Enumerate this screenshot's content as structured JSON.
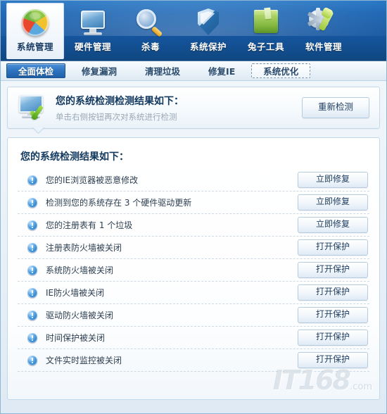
{
  "toolbar": {
    "items": [
      {
        "label": "系统管理",
        "icon": "pie-chart-icon",
        "active": true
      },
      {
        "label": "硬件管理",
        "icon": "monitor-icon",
        "active": false
      },
      {
        "label": "杀毒",
        "icon": "magnifier-icon",
        "active": false
      },
      {
        "label": "系统保护",
        "icon": "shield-icon",
        "active": false
      },
      {
        "label": "兔子工具",
        "icon": "box-icon",
        "active": false
      },
      {
        "label": "软件管理",
        "icon": "gear-wrench-icon",
        "active": false
      }
    ]
  },
  "tabs": [
    {
      "label": "全面体检",
      "state": "selected"
    },
    {
      "label": "修复漏洞",
      "state": "normal"
    },
    {
      "label": "清理垃圾",
      "state": "normal"
    },
    {
      "label": "修复IE",
      "state": "normal"
    },
    {
      "label": "系统优化",
      "state": "focused"
    }
  ],
  "header": {
    "icon": "monitor-check-icon",
    "title": "您的系统检测检测结果如下：",
    "subtitle": "单击右侧按钮再次对系统进行检测",
    "rescan_button": "重新检测"
  },
  "results": {
    "title": "您的系统检测结果如下：",
    "rows": [
      {
        "icon": "info-warning-icon",
        "label": "您的IE浏览器被恶意修改",
        "action": "立即修复"
      },
      {
        "icon": "info-warning-icon",
        "label": "检测到您的系统存在 3 个硬件驱动更新",
        "action": "立即修复"
      },
      {
        "icon": "info-warning-icon",
        "label": "您的注册表有 1 个垃圾",
        "action": "立即修复"
      },
      {
        "icon": "info-warning-icon",
        "label": "注册表防火墙被关闭",
        "action": "打开保护"
      },
      {
        "icon": "info-warning-icon",
        "label": "系统防火墙被关闭",
        "action": "打开保护"
      },
      {
        "icon": "info-warning-icon",
        "label": "IE防火墙被关闭",
        "action": "打开保护"
      },
      {
        "icon": "info-warning-icon",
        "label": "驱动防火墙被关闭",
        "action": "打开保护"
      },
      {
        "icon": "info-warning-icon",
        "label": "时间保护被关闭",
        "action": "打开保护"
      },
      {
        "icon": "info-warning-icon",
        "label": "文件实时监控被关闭",
        "action": "打开保护"
      }
    ]
  },
  "watermark": {
    "text": "IT168",
    "suffix": ".com"
  },
  "colors": {
    "toolbar_blue": "#1d66b4",
    "tab_selected": "#2f74bf",
    "title_text": "#143a60",
    "info_icon": "#1a6fc0",
    "panel_border": "#c3d9ea"
  }
}
